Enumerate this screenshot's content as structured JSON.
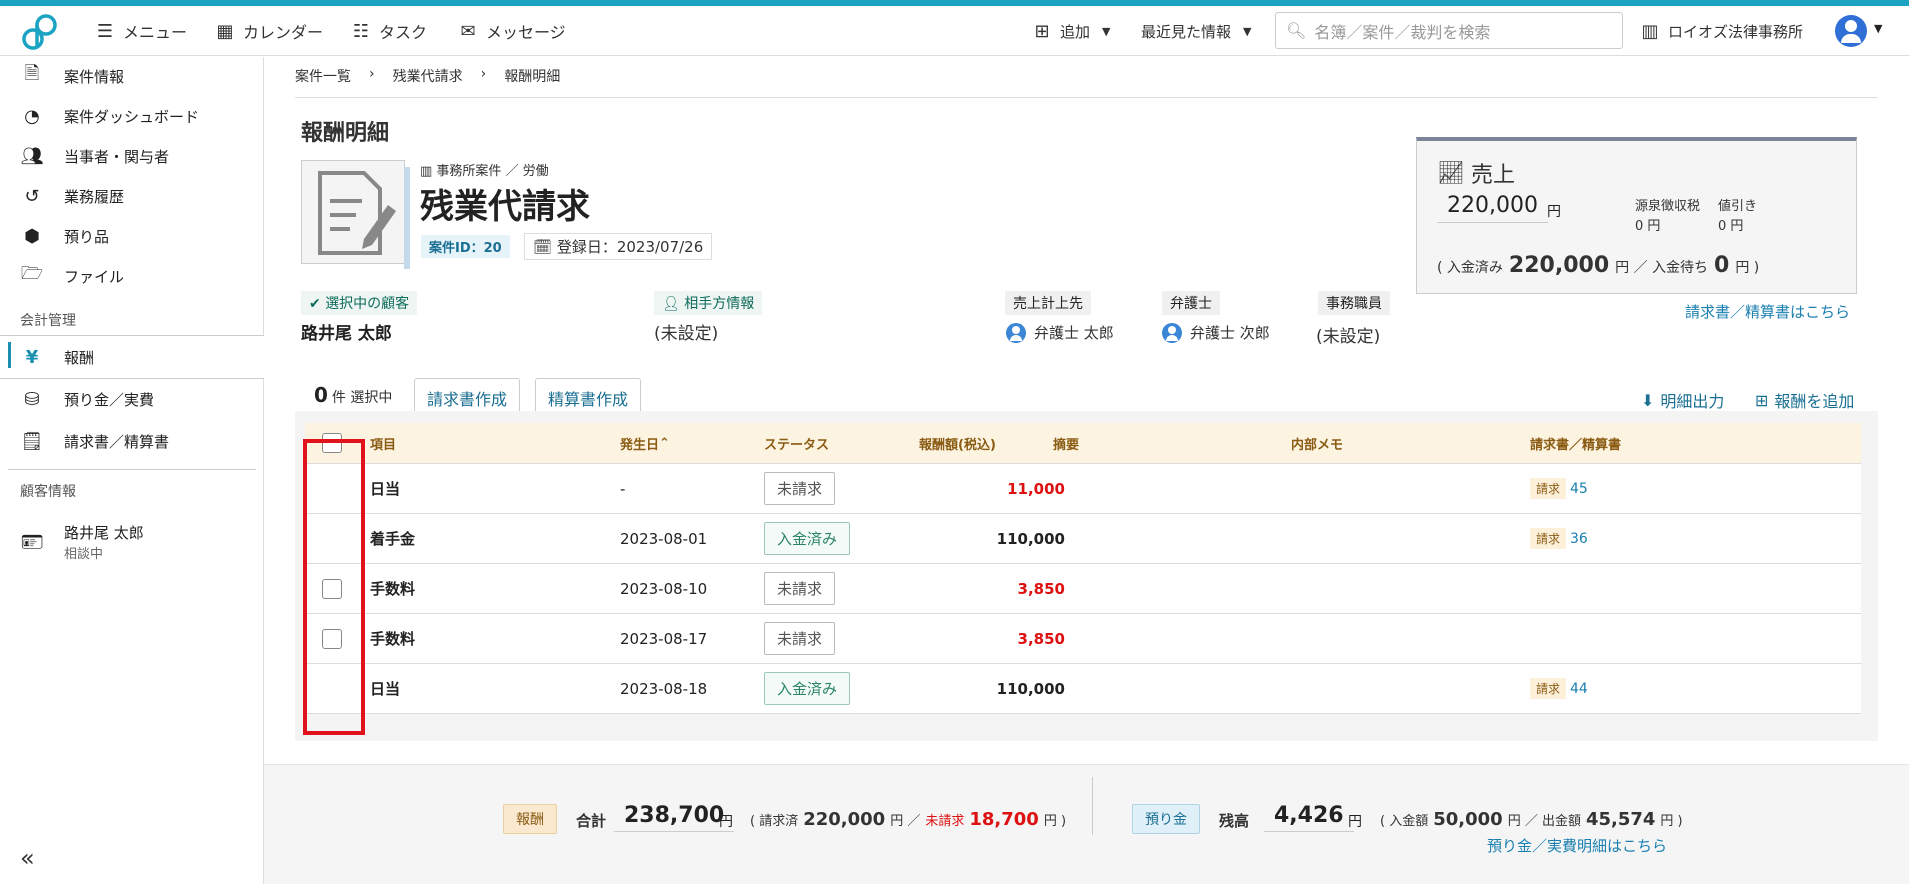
{
  "topbar": {
    "menu": "メニュー",
    "calendar": "カレンダー",
    "task": "タスク",
    "message": "メッセージ",
    "add": "追加",
    "recent": "最近見た情報",
    "search_placeholder": "名簿／案件／裁判を検索",
    "office": "ロイオズ法律事務所"
  },
  "sidebar": {
    "items": [
      {
        "label": "案件情報"
      },
      {
        "label": "案件ダッシュボード"
      },
      {
        "label": "当事者・関与者"
      },
      {
        "label": "業務履歴"
      },
      {
        "label": "預り品"
      },
      {
        "label": "ファイル"
      }
    ],
    "section_accounting": "会計管理",
    "accounting": [
      {
        "label": "報酬"
      },
      {
        "label": "預り金／実費"
      },
      {
        "label": "請求書／精算書"
      }
    ],
    "section_client": "顧客情報",
    "client_name": "路井尾 太郎",
    "client_status": "相談中"
  },
  "breadcrumb": [
    "案件一覧",
    "残業代請求",
    "報酬明細"
  ],
  "page_title": "報酬明細",
  "case": {
    "category": "事務所案件 ／ 労働",
    "title": "残業代請求",
    "id_label": "案件ID：20",
    "registered": "登録日：2023/07/26"
  },
  "parties": {
    "client_label": "選択中の顧客",
    "client_name": "路井尾 太郎",
    "opponent_label": "相手方情報",
    "opponent_value": "(未設定)",
    "sales_rep_label": "売上計上先",
    "sales_rep": "弁護士 太郎",
    "lawyer_label": "弁護士",
    "lawyer": "弁護士 次郎",
    "staff_label": "事務職員",
    "staff": "(未設定)"
  },
  "sales": {
    "title": "売上",
    "amount": "220,000",
    "unit": "円",
    "withholding_label": "源泉徴収税",
    "withholding": "0 円",
    "discount_label": "値引き",
    "discount": "0 円",
    "paid_prefix": "( 入金済み",
    "paid": "220,000",
    "paid_mid": "円 ／ 入金待ち",
    "pending": "0",
    "paid_suffix": "円 )",
    "link": "請求書／精算書はこちら"
  },
  "actions": {
    "selected_count": "0",
    "selected_label": "件 選択中",
    "invoice_btn": "請求書作成",
    "settlement_btn": "精算書作成",
    "export": "明細出力",
    "add_fee": "報酬を追加"
  },
  "table": {
    "headers": {
      "item": "項目",
      "date": "発生日",
      "status": "ステータス",
      "amount": "報酬額(税込)",
      "summary": "摘要",
      "memo": "内部メモ",
      "invoice": "請求書／精算書"
    },
    "rows": [
      {
        "item": "日当",
        "date": "-",
        "status": "未請求",
        "amount": "11,000",
        "inv_tag": "請求",
        "inv_num": "45"
      },
      {
        "item": "着手金",
        "date": "2023-08-01",
        "status": "入金済み",
        "amount": "110,000",
        "inv_tag": "請求",
        "inv_num": "36"
      },
      {
        "item": "手数料",
        "date": "2023-08-10",
        "status": "未請求",
        "amount": "3,850",
        "inv_tag": "",
        "inv_num": ""
      },
      {
        "item": "手数料",
        "date": "2023-08-17",
        "status": "未請求",
        "amount": "3,850",
        "inv_tag": "",
        "inv_num": ""
      },
      {
        "item": "日当",
        "date": "2023-08-18",
        "status": "入金済み",
        "amount": "110,000",
        "inv_tag": "請求",
        "inv_num": "44"
      }
    ]
  },
  "footer": {
    "fee_tag": "報酬",
    "total_label": "合計",
    "total": "238,700",
    "unit": "円",
    "billed_prefix": "( 請求済",
    "billed": "220,000",
    "billed_unit": "円 ／",
    "unbilled_label": "未請求",
    "unbilled": "18,700",
    "unbilled_unit": "円 )",
    "deposit_tag": "預り金",
    "balance_label": "残高",
    "balance": "4,426",
    "in_prefix": "( 入金額",
    "in_amount": "50,000",
    "out_label": "円 ／ 出金額",
    "out_amount": "45,574",
    "out_suffix": "円 )",
    "deposit_link": "預り金／実費明細はこちら"
  },
  "colors": {
    "accent": "#1aa3c2",
    "link": "#1a7fb0",
    "red": "#d11111",
    "highlight": "#e0121b"
  }
}
